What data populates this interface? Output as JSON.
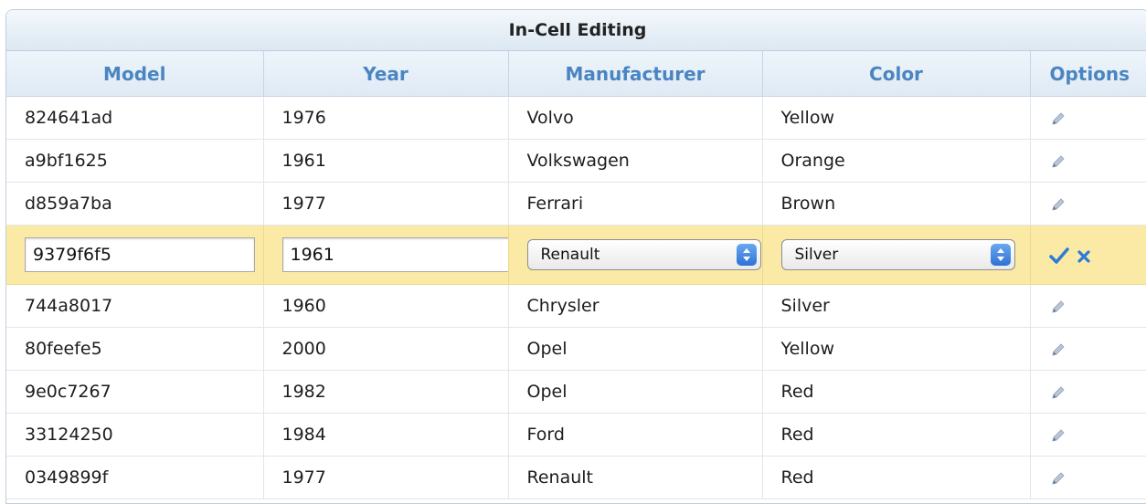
{
  "grid": {
    "title": "In-Cell Editing",
    "columns": [
      "Model",
      "Year",
      "Manufacturer",
      "Color",
      "Options"
    ],
    "rows_before": [
      {
        "model": "824641ad",
        "year": "1976",
        "manufacturer": "Volvo",
        "color": "Yellow"
      },
      {
        "model": "a9bf1625",
        "year": "1961",
        "manufacturer": "Volkswagen",
        "color": "Orange"
      },
      {
        "model": "d859a7ba",
        "year": "1977",
        "manufacturer": "Ferrari",
        "color": "Brown"
      }
    ],
    "editing_row": {
      "model": "9379f6f5",
      "year": "1961",
      "manufacturer": "Renault",
      "color": "Silver"
    },
    "rows_after": [
      {
        "model": "744a8017",
        "year": "1960",
        "manufacturer": "Chrysler",
        "color": "Silver"
      },
      {
        "model": "80feefe5",
        "year": "2000",
        "manufacturer": "Opel",
        "color": "Yellow"
      },
      {
        "model": "9e0c7267",
        "year": "1982",
        "manufacturer": "Opel",
        "color": "Red"
      },
      {
        "model": "33124250",
        "year": "1984",
        "manufacturer": "Ford",
        "color": "Red"
      },
      {
        "model": "0349899f",
        "year": "1977",
        "manufacturer": "Renault",
        "color": "Red"
      }
    ]
  },
  "icons": {
    "row_action": "pencil-icon",
    "save": "checkmark-icon",
    "cancel": "x-icon"
  },
  "colors": {
    "header_text": "#4a85c2",
    "editing_row_bg": "#fbeaa6",
    "icon_blue": "#2c7bd6"
  }
}
